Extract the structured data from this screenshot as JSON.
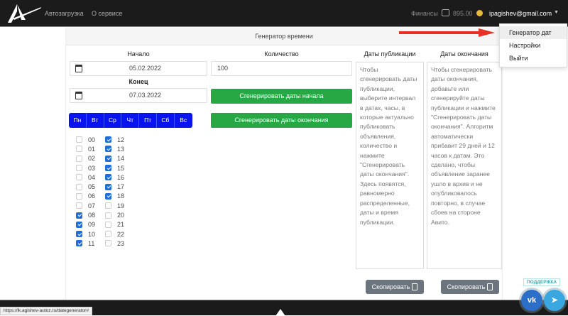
{
  "header": {
    "nav": [
      "Автозагрузка",
      "О сервисе"
    ],
    "finance_label": "Финансы",
    "balance": "895.00",
    "email": "ipagishev@gmail.com"
  },
  "dropdown": [
    "Генератор дат",
    "Настройки",
    "Выйти"
  ],
  "panel": {
    "title": "Генератор времени",
    "start_label": "Начало",
    "start_value": "05.02.2022",
    "end_label": "Конец",
    "end_value": "07.03.2022",
    "count_label": "Количество",
    "count_value": "100",
    "gen_start_button": "Сгенерировать даты начала",
    "gen_end_button": "Сгенерировать даты окончания",
    "weekdays": [
      "Пн",
      "Вт",
      "Ср",
      "Чт",
      "Пт",
      "Сб",
      "Вс"
    ],
    "hours": [
      {
        "h": "00",
        "on": false
      },
      {
        "h": "01",
        "on": false
      },
      {
        "h": "02",
        "on": false
      },
      {
        "h": "03",
        "on": false
      },
      {
        "h": "04",
        "on": false
      },
      {
        "h": "05",
        "on": false
      },
      {
        "h": "06",
        "on": false
      },
      {
        "h": "07",
        "on": false
      },
      {
        "h": "08",
        "on": true
      },
      {
        "h": "09",
        "on": true
      },
      {
        "h": "10",
        "on": true
      },
      {
        "h": "11",
        "on": true
      },
      {
        "h": "12",
        "on": true
      },
      {
        "h": "13",
        "on": true
      },
      {
        "h": "14",
        "on": true
      },
      {
        "h": "15",
        "on": true
      },
      {
        "h": "16",
        "on": true
      },
      {
        "h": "17",
        "on": true
      },
      {
        "h": "18",
        "on": true
      },
      {
        "h": "19",
        "on": false
      },
      {
        "h": "20",
        "on": false
      },
      {
        "h": "21",
        "on": false
      },
      {
        "h": "22",
        "on": false
      },
      {
        "h": "23",
        "on": false
      }
    ],
    "pub_label": "Даты публикации",
    "pub_text": "Чтобы сгенерировать даты публикации, выберите интервал в датах, часы, в которые актуально публиковать объявления, количество и нажмите \"Сгенерировать даты окончания\". Здесь появятся, равномерно распределенные, даты и время публикации.",
    "end_dates_label": "Даты окончания",
    "end_text": "Чтобы сгенерировать даты окончания, добавьте или сгенерируйте даты публикации и нажмите \"Сгенерировать даты окончания\". Алгоритм автоматически прибавит 29 дней и 12 часов к датам. Это сделано, чтобы объявление заранее ушло в архив и не опубликовалось повторно, в случае сбоев на стороне Авито.",
    "copy_label": "Скопировать"
  },
  "support_label": "ПОДДЕРЖКА",
  "status_url": "https://lk.agishev-autoz.ru/dategenerator#",
  "colors": {
    "weekday": "#0a14ee",
    "green": "#27a844",
    "checkbox": "#1f6fd6",
    "arrow": "#e53222"
  }
}
